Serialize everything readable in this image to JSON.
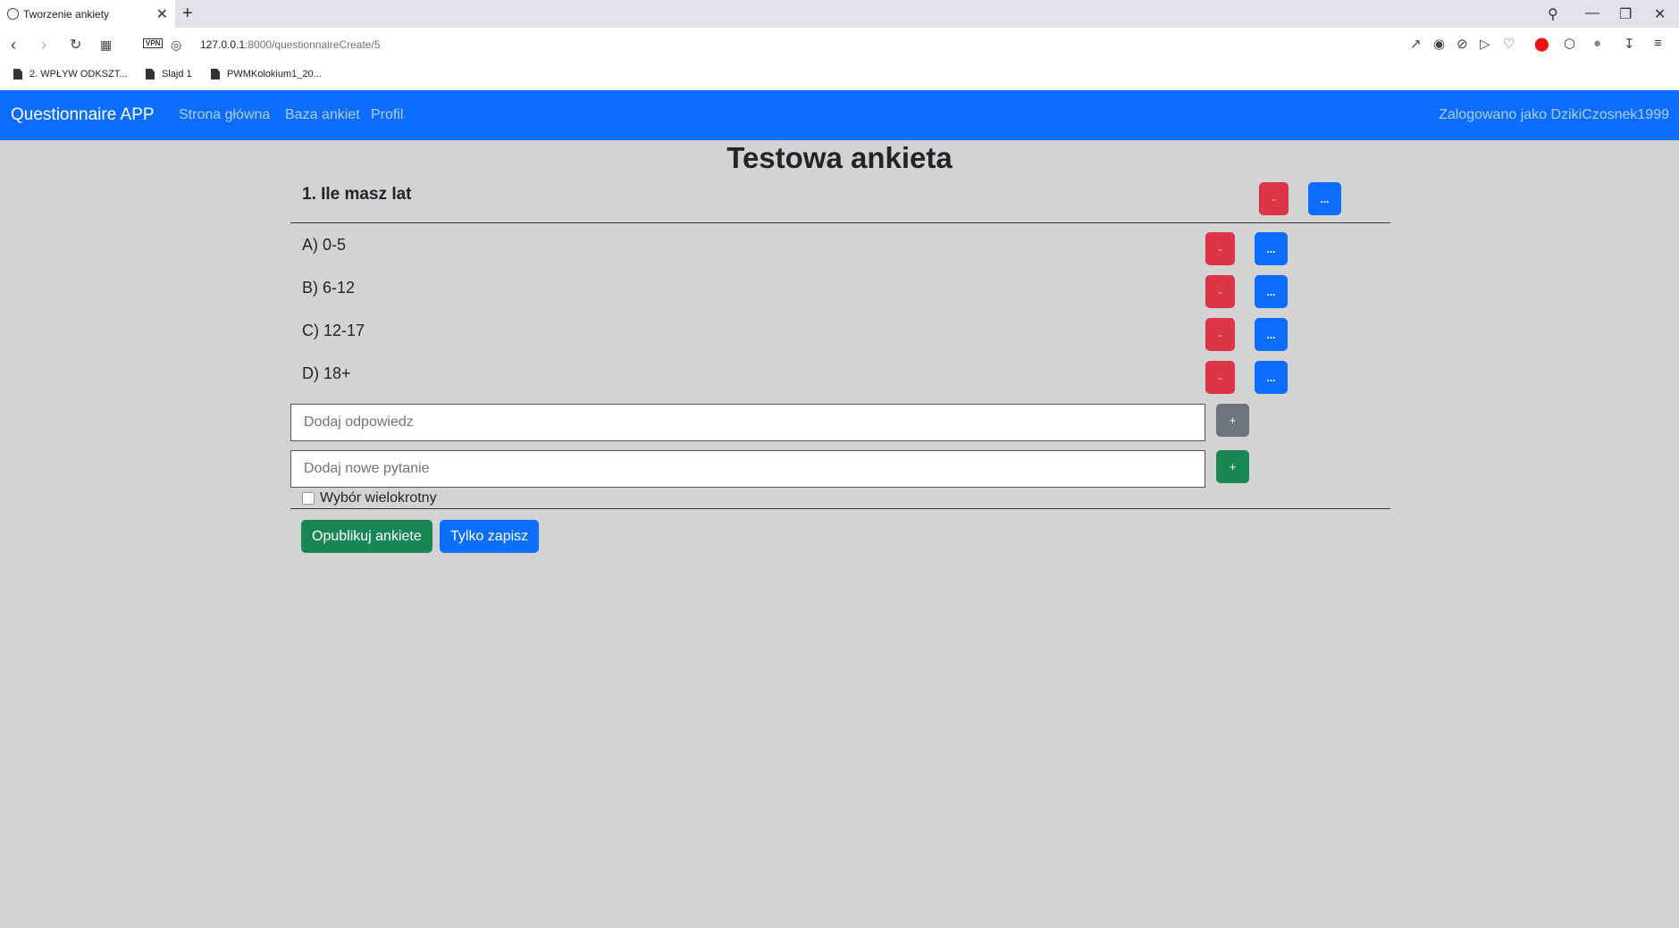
{
  "browser": {
    "tab_title": "Tworzenie ankiety",
    "tab_close": "✕",
    "new_tab": "+",
    "vpn_label": "VPN",
    "url_host": "127.0.0.1",
    "url_rest": ":8000/questionnaireCreate/5",
    "bookmarks": [
      {
        "label": "2. WPŁYW ODKSZT..."
      },
      {
        "label": "Slajd 1"
      },
      {
        "label": "PWMKolokium1_20..."
      }
    ]
  },
  "navbar": {
    "brand": "Questionnaire APP",
    "links": [
      {
        "label": "Strona główna"
      },
      {
        "label": "Baza ankiet"
      },
      {
        "label": "Profil"
      }
    ],
    "user_status": "Zalogowano jako DzikiCzosnek1999"
  },
  "main": {
    "title": "Testowa ankieta",
    "question": {
      "text": "1. Ile masz lat",
      "delete_label": "-",
      "edit_label": "..."
    },
    "answers": [
      {
        "text": "A) 0-5",
        "delete_label": "-",
        "edit_label": "..."
      },
      {
        "text": "B) 6-12",
        "delete_label": "-",
        "edit_label": "..."
      },
      {
        "text": "C) 12-17",
        "delete_label": "-",
        "edit_label": "..."
      },
      {
        "text": "D) 18+",
        "delete_label": "-",
        "edit_label": "..."
      }
    ],
    "add_answer": {
      "placeholder": "Dodaj odpowiedz",
      "button_label": "+"
    },
    "add_question": {
      "placeholder": "Dodaj nowe pytanie",
      "button_label": "+"
    },
    "multiple_choice": {
      "label": "Wybór wielokrotny",
      "checked": false
    },
    "publish_label": "Opublikuj ankiete",
    "save_label": "Tylko zapisz"
  },
  "colors": {
    "primary": "#0d6efd",
    "danger": "#dc3545",
    "secondary": "#6c757d",
    "success": "#198754",
    "background": "#d3d3d3"
  }
}
